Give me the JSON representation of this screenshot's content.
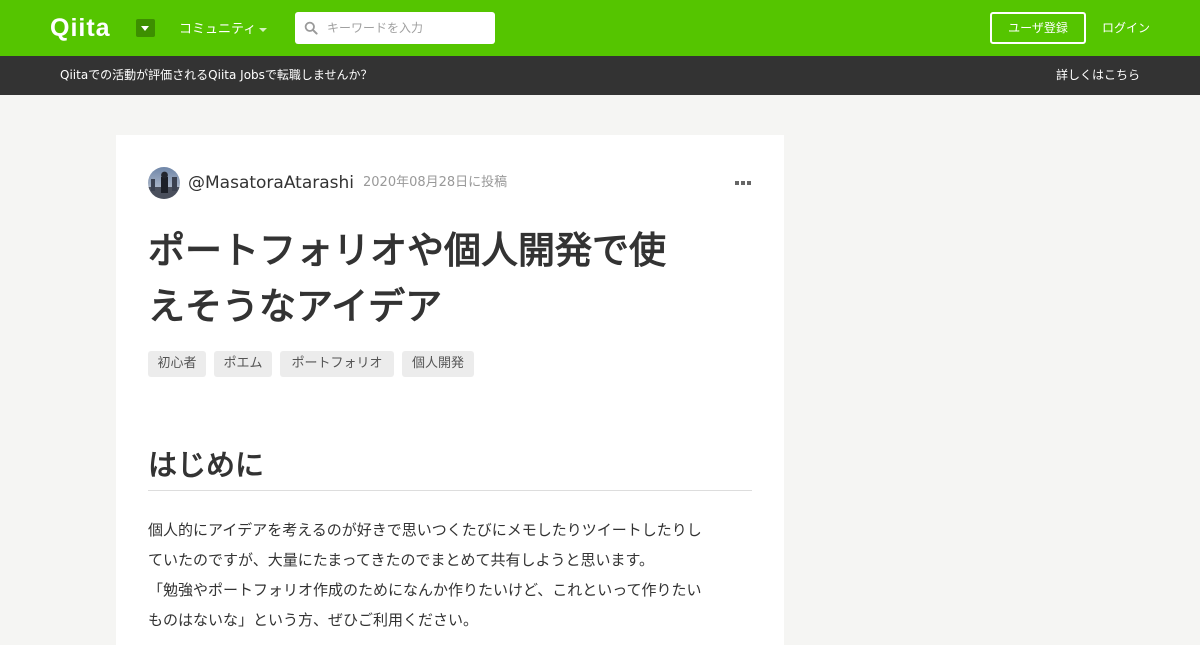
{
  "header": {
    "logo": "Qiita",
    "logo_dropdown_icon": "caret-down-icon",
    "community_label": "コミュニティ",
    "search_icon": "search-icon",
    "search_placeholder": "キーワードを入力",
    "search_value": "",
    "signup_label": "ユーザ登録",
    "login_label": "ログイン",
    "accent_color": "#55c500"
  },
  "banner": {
    "text": "Qiitaでの活動が評価されるQiita Jobsで転職しませんか？",
    "link_label": "詳しくはこちら",
    "background_color": "#333333"
  },
  "article": {
    "author": "@MasatoraAtarashi",
    "posted": "2020年08月28日に投稿",
    "more_icon": "more-horizontal-icon",
    "title_line1": "ポートフォリオや個人開発で使",
    "title_line2": "えそうなアイデア",
    "tags": [
      "初心者",
      "ポエム",
      "ポートフォリオ",
      "個人開発"
    ],
    "section_heading": "はじめに",
    "paragraph_lines": [
      "個人的にアイデアを考えるのが好きで思いつくたびにメモしたりツイートしたりし",
      "ていたのですが、大量にたまってきたのでまとめて共有しようと思います。",
      "「勉強やポートフォリオ作成のためになんか作りたいけど、これといって作りたい",
      "ものはないな」という方、ぜひご利用ください。"
    ]
  }
}
